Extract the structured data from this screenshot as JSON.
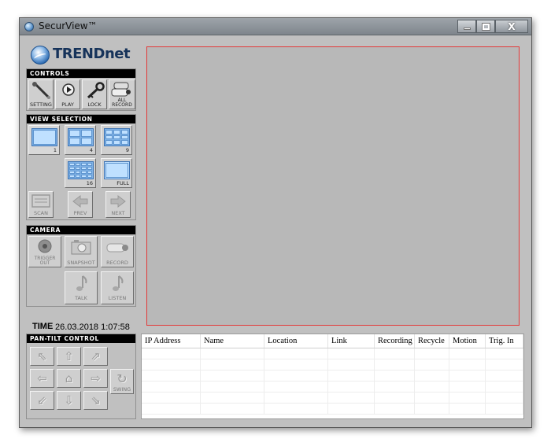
{
  "window": {
    "title": "SecurView™",
    "close_label": "X"
  },
  "logo": {
    "text": "TRENDnet"
  },
  "controls": {
    "header": "CONTROLS",
    "buttons": [
      {
        "id": "setting",
        "label": "SETTING",
        "icon": "wrench-icon"
      },
      {
        "id": "play",
        "label": "PLAY",
        "icon": "play-icon"
      },
      {
        "id": "lock",
        "label": "LOCK",
        "icon": "key-icon"
      },
      {
        "id": "all-record",
        "label": "ALL RECORD",
        "icon": "cameras-icon"
      }
    ]
  },
  "view_selection": {
    "header": "VIEW SELECTION",
    "views": [
      {
        "label": "1",
        "grid": 1
      },
      {
        "label": "4",
        "grid": 2
      },
      {
        "label": "9",
        "grid": 3
      },
      {
        "label": "16",
        "grid": 4
      },
      {
        "label": "FULL",
        "grid": 0
      }
    ],
    "scan_label": "SCAN",
    "prev_label": "PREV",
    "next_label": "NEXT"
  },
  "camera": {
    "header": "CAMERA",
    "trigger_out_label": "TRIGGER OUT",
    "snapshot_label": "SNAPSHOT",
    "record_label": "RECORD",
    "talk_label": "TALK",
    "listen_label": "LISTEN"
  },
  "time": {
    "label": "TIME",
    "value": "26.03.2018 1:07:58"
  },
  "ptz": {
    "header": "PAN-TILT CONTROL",
    "swing_label": "SWING"
  },
  "table": {
    "columns": [
      "IP Address",
      "Name",
      "Location",
      "Link",
      "Recording",
      "Recycle",
      "Motion",
      "Trig. In"
    ],
    "rows": [
      [],
      [],
      [],
      [],
      [],
      []
    ]
  },
  "colors": {
    "video_border": "#e23a3a",
    "panel_bg": "#c0c0c0",
    "header_bg": "#000000"
  }
}
